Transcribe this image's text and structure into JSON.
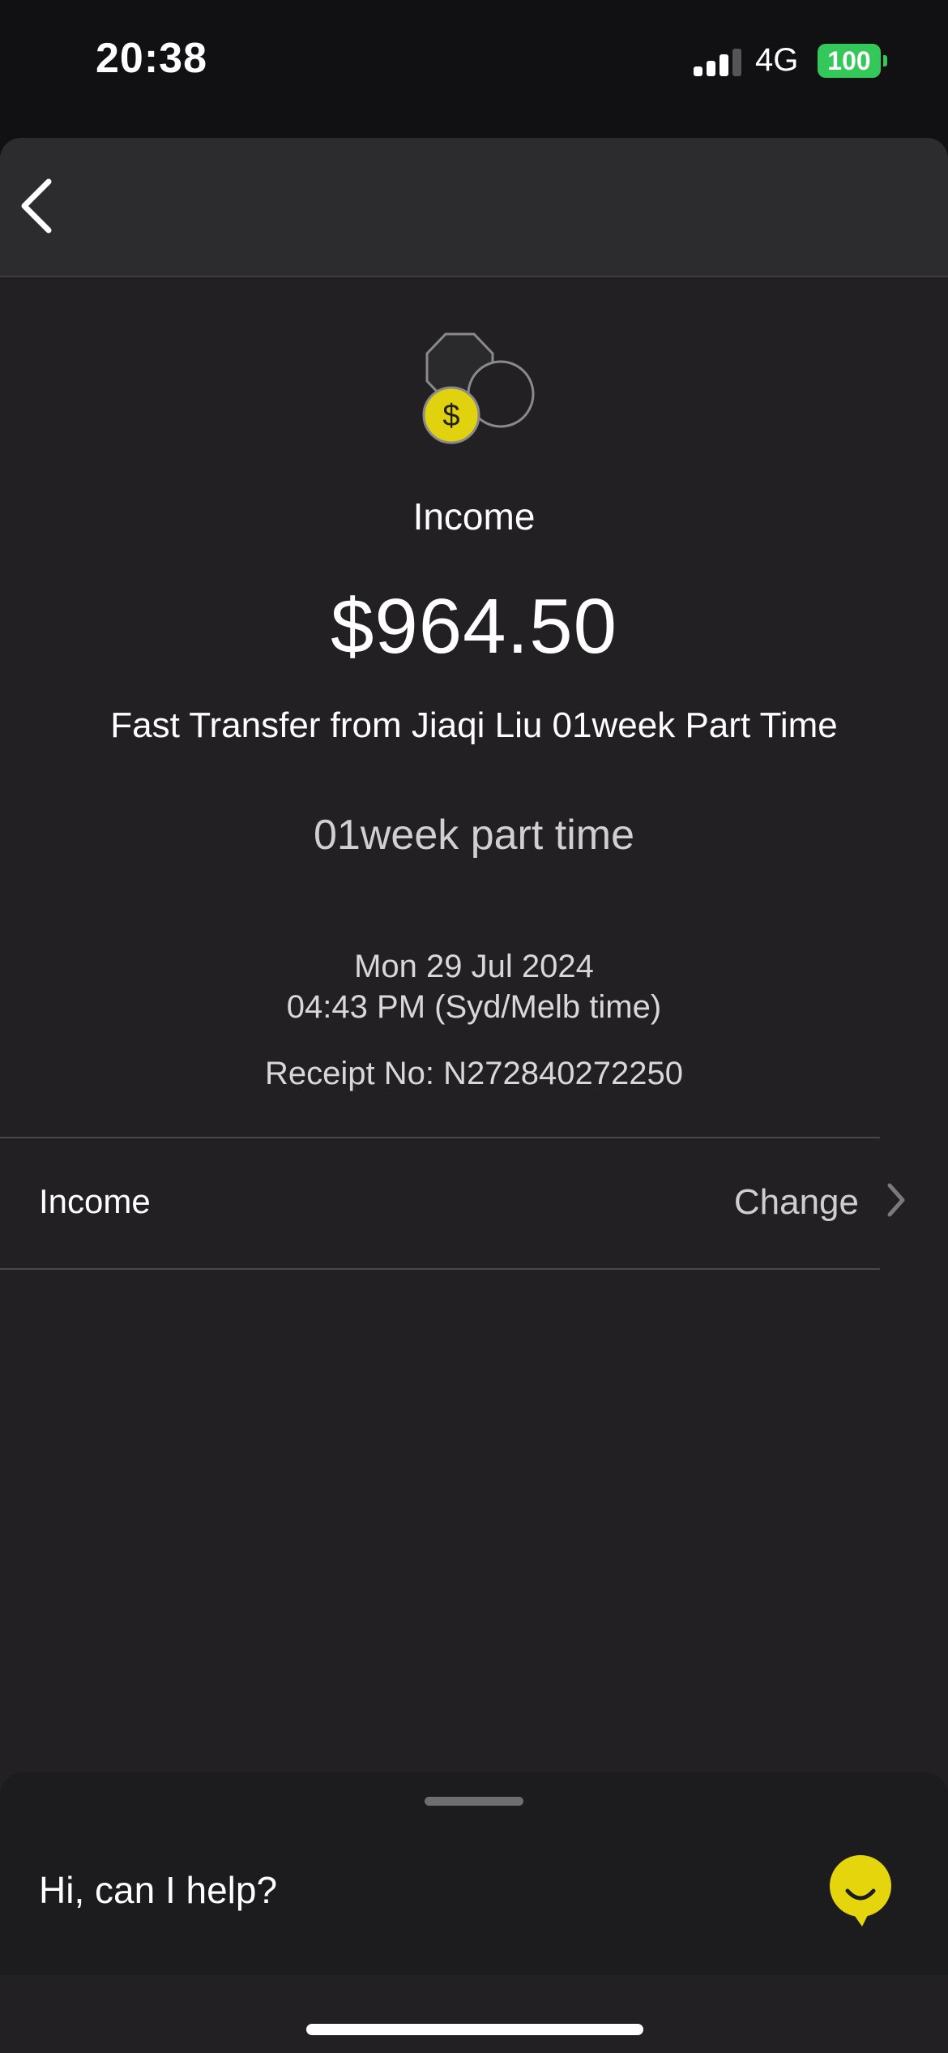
{
  "status_bar": {
    "time": "20:38",
    "network": "4G",
    "battery": "100"
  },
  "nav": {
    "back_icon": "chevron-left-icon"
  },
  "transaction": {
    "icon": "coins-icon",
    "category": "Income",
    "amount": "$964.50",
    "description": "Fast Transfer from Jiaqi Liu 01week Part Time",
    "note": "01week part time",
    "date": "Mon 29 Jul 2024",
    "time": "04:43 PM (Syd/Melb time)",
    "receipt": "Receipt No: N272840272250"
  },
  "category_row": {
    "label": "Income",
    "action": "Change",
    "icon": "chevron-right-icon"
  },
  "assistant": {
    "prompt": "Hi, can I help?",
    "icon": "smiley-chat-icon"
  },
  "colors": {
    "accent_yellow": "#e5d50d",
    "battery_green": "#34c759",
    "background": "#222022"
  }
}
